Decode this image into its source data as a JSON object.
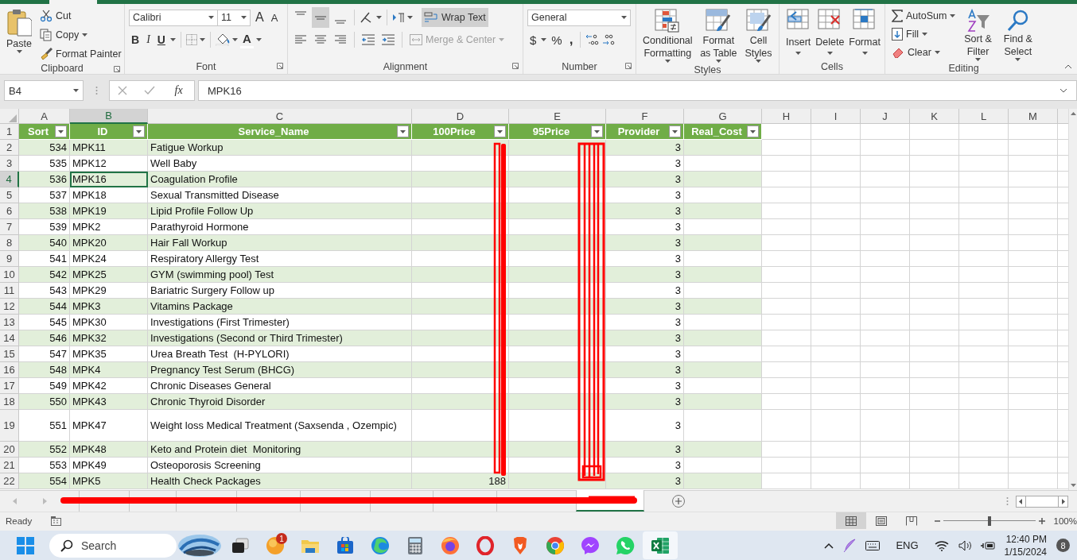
{
  "ribbon": {
    "clipboard": {
      "label": "Clipboard",
      "paste": "Paste",
      "cut": "Cut",
      "copy": "Copy",
      "format_painter": "Format Painter"
    },
    "font": {
      "label": "Font",
      "family": "Calibri",
      "size": "11",
      "size_buttons": [
        "A",
        "A"
      ],
      "style_buttons": [
        "B",
        "I",
        "U"
      ],
      "color_button": "A"
    },
    "alignment": {
      "label": "Alignment",
      "vertical_align": [
        {
          "selected": false
        },
        {
          "selected": true
        },
        {
          "selected": false
        }
      ],
      "wrap_text": {
        "label": "Wrap Text",
        "on": true
      },
      "merge_center": {
        "label": "Merge & Center",
        "disabled": true
      }
    },
    "number": {
      "label": "Number",
      "format": "General",
      "symbols": [
        "$",
        "%",
        ","
      ]
    },
    "styles": {
      "label": "Styles",
      "buttons": [
        "Conditional Formatting",
        "Format as Table",
        "Cell Styles"
      ]
    },
    "cells": {
      "label": "Cells",
      "buttons": [
        "Insert",
        "Delete",
        "Format"
      ]
    },
    "editing": {
      "label": "Editing",
      "autosum": "AutoSum",
      "fill": "Fill",
      "clear": "Clear",
      "sort_filter": "Sort & Filter",
      "find_select": "Find & Select"
    }
  },
  "formula_bar": {
    "name_box": "B4",
    "function_label": "fx",
    "formula": "MPK16"
  },
  "sheet": {
    "columns": [
      {
        "letter": "A",
        "selected": false
      },
      {
        "letter": "B",
        "selected": true
      },
      {
        "letter": "C",
        "selected": false
      },
      {
        "letter": "D",
        "selected": false
      },
      {
        "letter": "E",
        "selected": false
      },
      {
        "letter": "F",
        "selected": false
      },
      {
        "letter": "G",
        "selected": false
      },
      {
        "letter": "H",
        "selected": false
      },
      {
        "letter": "I",
        "selected": false
      },
      {
        "letter": "J",
        "selected": false
      },
      {
        "letter": "K",
        "selected": false
      },
      {
        "letter": "L",
        "selected": false
      },
      {
        "letter": "M",
        "selected": false
      }
    ],
    "header_row_number": "1",
    "header": [
      "Sort",
      "ID",
      "Service_Name",
      "100Price",
      "95Price",
      "Provider",
      "Real_Cost"
    ],
    "rows": [
      {
        "number": "2",
        "sort": "534",
        "id": "MPK11",
        "service": "Fatigue Workup",
        "provider": "3",
        "selected": false
      },
      {
        "number": "3",
        "sort": "535",
        "id": "MPK12",
        "service": "Well Baby",
        "provider": "3",
        "selected": false
      },
      {
        "number": "4",
        "sort": "536",
        "id": "MPK16",
        "service": "Coagulation Profile",
        "provider": "3",
        "selected": true
      },
      {
        "number": "5",
        "sort": "537",
        "id": "MPK18",
        "service": "Sexual Transmitted Disease",
        "provider": "3",
        "selected": false
      },
      {
        "number": "6",
        "sort": "538",
        "id": "MPK19",
        "service": "Lipid Profile Follow Up",
        "provider": "3",
        "selected": false
      },
      {
        "number": "7",
        "sort": "539",
        "id": "MPK2",
        "service": "Parathyroid Hormone",
        "provider": "3",
        "selected": false
      },
      {
        "number": "8",
        "sort": "540",
        "id": "MPK20",
        "service": "Hair Fall Workup",
        "provider": "3",
        "selected": false
      },
      {
        "number": "9",
        "sort": "541",
        "id": "MPK24",
        "service": "Respiratory Allergy Test",
        "provider": "3",
        "selected": false
      },
      {
        "number": "10",
        "sort": "542",
        "id": "MPK25",
        "service": "GYM (swimming pool) Test",
        "provider": "3",
        "selected": false
      },
      {
        "number": "11",
        "sort": "543",
        "id": "MPK29",
        "service": "Bariatric Surgery Follow up",
        "provider": "3",
        "selected": false
      },
      {
        "number": "12",
        "sort": "544",
        "id": "MPK3",
        "service": "Vitamins Package",
        "provider": "3",
        "selected": false
      },
      {
        "number": "13",
        "sort": "545",
        "id": "MPK30",
        "service": "Investigations (First Trimester)",
        "provider": "3",
        "selected": false
      },
      {
        "number": "14",
        "sort": "546",
        "id": "MPK32",
        "service": "Investigations (Second or Third Trimester)",
        "provider": "3",
        "selected": false
      },
      {
        "number": "15",
        "sort": "547",
        "id": "MPK35",
        "service": "Urea Breath Test  (H-PYLORI)",
        "provider": "3",
        "selected": false
      },
      {
        "number": "16",
        "sort": "548",
        "id": "MPK4",
        "service": "Pregnancy Test Serum (BHCG)",
        "provider": "3",
        "selected": false
      },
      {
        "number": "17",
        "sort": "549",
        "id": "MPK42",
        "service": "Chronic Diseases General",
        "provider": "3",
        "selected": false
      },
      {
        "number": "18",
        "sort": "550",
        "id": "MPK43",
        "service": "Chronic Thyroid Disorder",
        "provider": "3",
        "selected": false
      },
      {
        "number": "19",
        "sort": "551",
        "id": "MPK47",
        "service": "Weight loss Medical Treatment (Saxsenda , Ozempic)",
        "provider": "3",
        "selected": false
      },
      {
        "number": "20",
        "sort": "552",
        "id": "MPK48",
        "service": "Keto and Protein diet  Monitoring",
        "provider": "3",
        "selected": false
      },
      {
        "number": "21",
        "sort": "553",
        "id": "MPK49",
        "service": "Osteoporosis Screening",
        "provider": "3",
        "selected": false
      },
      {
        "number": "22",
        "sort": "554",
        "id": "MPK5",
        "service": "Health Check Packages",
        "price_100": "188",
        "provider": "3",
        "selected": false
      }
    ]
  },
  "sheet_tabs": [
    {
      "selected": false
    },
    {
      "selected": false
    },
    {
      "selected": false
    },
    {
      "selected": false
    },
    {
      "selected": false
    },
    {
      "selected": false
    },
    {
      "selected": false
    },
    {
      "selected": false
    },
    {
      "selected": true
    }
  ],
  "status_bar": {
    "status": "Ready",
    "views": [
      {
        "selected": true
      },
      {
        "selected": false
      },
      {
        "selected": false
      }
    ],
    "zoom_slider": {
      "level": 0.5
    },
    "zoom": "100%"
  },
  "taskbar": {
    "search": "Search",
    "apps": [
      {
        "kind": "widgets",
        "active": false
      },
      {
        "kind": "taskview",
        "active": false
      },
      {
        "kind": "orange",
        "badge": "1",
        "active": false
      },
      {
        "kind": "folder",
        "active": false
      },
      {
        "kind": "store",
        "active": false
      },
      {
        "kind": "edge",
        "active": false
      },
      {
        "kind": "calculator",
        "active": false
      },
      {
        "kind": "firefox",
        "active": false
      },
      {
        "kind": "opera",
        "active": false
      },
      {
        "kind": "brave",
        "active": false
      },
      {
        "kind": "chrome",
        "active": false
      },
      {
        "kind": "messenger",
        "active": false
      },
      {
        "kind": "whatsapp",
        "active": false
      },
      {
        "kind": "excel",
        "active": true
      }
    ],
    "language": "ENG",
    "time": "12:40 PM",
    "date": "1/15/2024",
    "notifications": "8"
  }
}
